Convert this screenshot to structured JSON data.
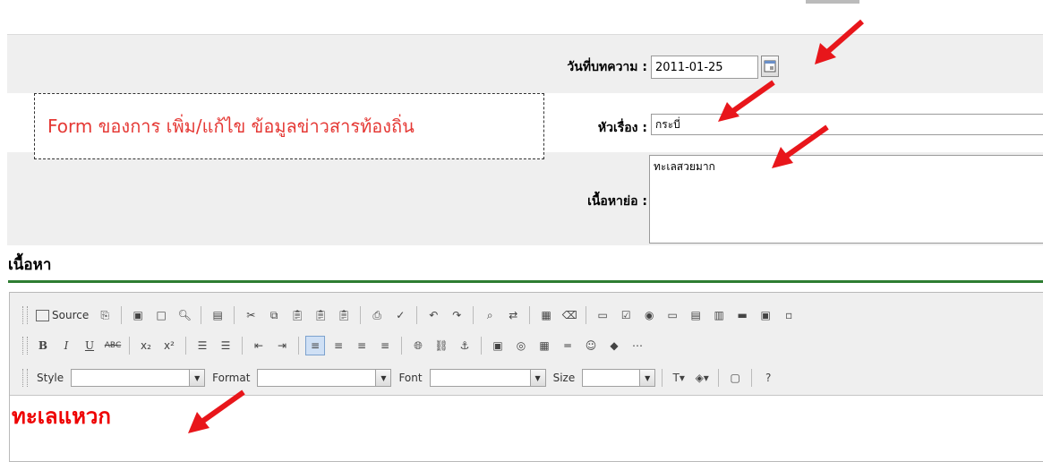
{
  "form": {
    "date_label": "วันที่บทความ :",
    "date_value": "2011-01-25",
    "title_label": "หัวเรื่อง :",
    "title_value": "กระบี่",
    "summary_label": "เนื้อหาย่อ :",
    "summary_value": "ทะเลสวยมาก"
  },
  "annotation": "Form ของการ เพิ่ม/แก้ไข ข้อมูลข่าวสารท้องถิ่น",
  "section_title": "เนื้อหา",
  "editor": {
    "source_label": "Source",
    "style_label": "Style",
    "format_label": "Format",
    "font_label": "Font",
    "size_label": "Size",
    "content": "ทะเลแหวก"
  },
  "colors": {
    "arrow": "#e8161b",
    "annotation_text": "#e53935",
    "content_text": "#ee0000",
    "divider": "#2e7d32"
  }
}
